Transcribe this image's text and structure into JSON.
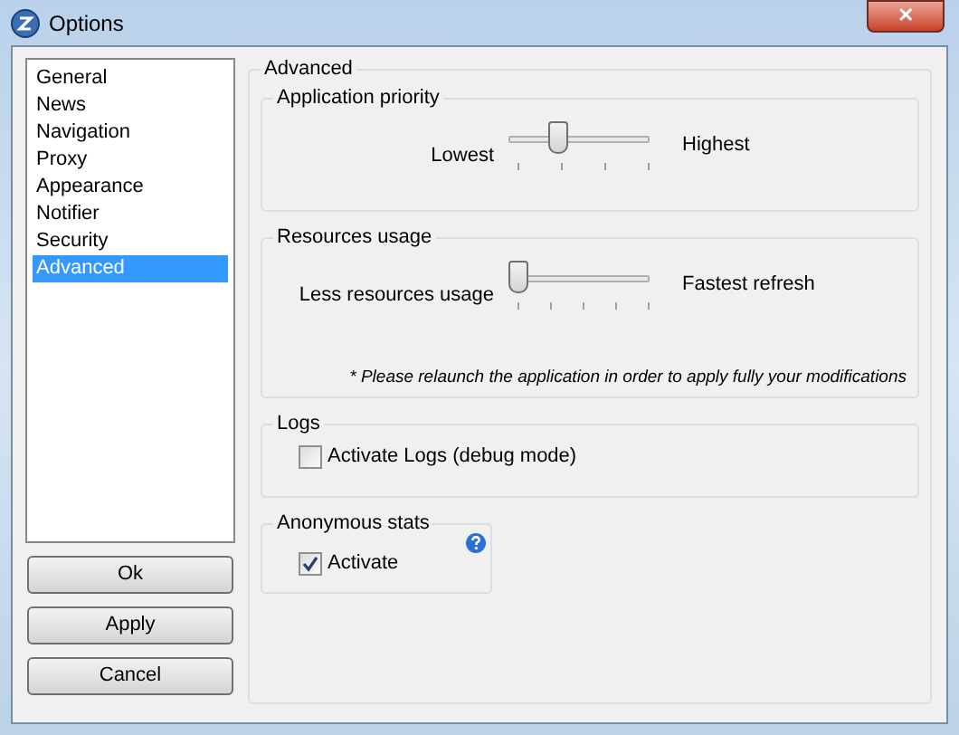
{
  "window": {
    "title": "Options",
    "close": "✕"
  },
  "sidebar": {
    "items": [
      {
        "label": "General",
        "selected": false
      },
      {
        "label": "News",
        "selected": false
      },
      {
        "label": "Navigation",
        "selected": false
      },
      {
        "label": "Proxy",
        "selected": false
      },
      {
        "label": "Appearance",
        "selected": false
      },
      {
        "label": "Notifier",
        "selected": false
      },
      {
        "label": "Security",
        "selected": false
      },
      {
        "label": "Advanced",
        "selected": true
      }
    ]
  },
  "buttons": [
    "Ok",
    "Apply",
    "Cancel"
  ],
  "panel": {
    "title": "Advanced",
    "sliders": [
      {
        "title": "Application priority",
        "min_label": "Lowest",
        "max_label": "Highest",
        "level": 0.33
      },
      {
        "title": "Resources usage",
        "min_label": "Less resources usage",
        "max_label": "Fastest refresh",
        "level": 0,
        "note": "* Please relaunch the application in order to apply fully your modifications"
      }
    ],
    "logs": {
      "title": "Logs",
      "label": "Activate Logs (debug mode)",
      "checked": false
    },
    "stats": {
      "title": "Anonymous stats",
      "label": "Activate",
      "checked": true
    }
  }
}
